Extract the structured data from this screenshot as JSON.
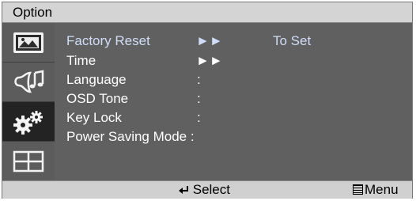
{
  "window": {
    "title": "Option"
  },
  "sidebar": {
    "items": [
      {
        "icon": "picture-icon",
        "active": false
      },
      {
        "icon": "sound-icon",
        "active": false
      },
      {
        "icon": "gears-icon",
        "active": true
      },
      {
        "icon": "grid-icon",
        "active": false
      }
    ]
  },
  "menu": {
    "rows": [
      {
        "label": "Factory Reset",
        "value": "►►",
        "extra": "To Set"
      },
      {
        "label": "Time",
        "value": "►►",
        "extra": ""
      },
      {
        "label": "Language",
        "value": ":",
        "extra": ""
      },
      {
        "label": "OSD Tone",
        "value": ":",
        "extra": ""
      },
      {
        "label": "Key Lock",
        "value": ":",
        "extra": ""
      },
      {
        "label": "Power Saving Mode :",
        "value": "",
        "extra": ""
      }
    ]
  },
  "footer": {
    "select_label": "Select",
    "menu_label": "Menu"
  }
}
